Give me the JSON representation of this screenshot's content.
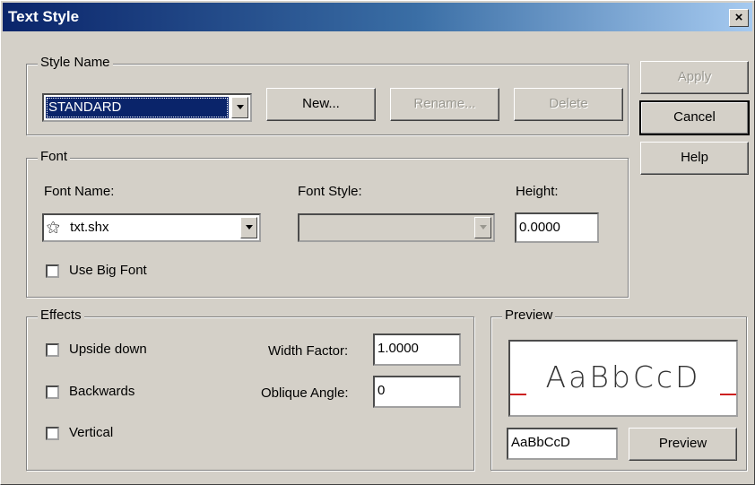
{
  "window": {
    "title": "Text Style",
    "close_glyph": "×"
  },
  "style_name": {
    "group_label": "Style Name",
    "selected_value": "STANDARD",
    "new_label": "New...",
    "rename_label": "Rename...",
    "delete_label": "Delete"
  },
  "side_buttons": {
    "apply_label": "Apply",
    "cancel_label": "Cancel",
    "help_label": "Help"
  },
  "font": {
    "group_label": "Font",
    "font_name_label": "Font Name:",
    "font_name_value": "txt.shx",
    "font_style_label": "Font Style:",
    "font_style_value": "",
    "height_label": "Height:",
    "height_value": "0.0000",
    "big_font_label": "Use Big Font"
  },
  "effects": {
    "group_label": "Effects",
    "upside_down_label": "Upside down",
    "backwards_label": "Backwards",
    "vertical_label": "Vertical",
    "width_factor_label": "Width Factor:",
    "width_factor_value": "1.0000",
    "oblique_angle_label": "Oblique Angle:",
    "oblique_angle_value": "0"
  },
  "preview": {
    "group_label": "Preview",
    "sample_text": "AaBbCcD",
    "input_value": "AaBbCcD",
    "button_label": "Preview"
  },
  "colors": {
    "dialog_bg": "#d4d0c8",
    "title_start": "#0a246a",
    "title_end": "#a6caf0",
    "baseline_red": "#cc2020"
  }
}
